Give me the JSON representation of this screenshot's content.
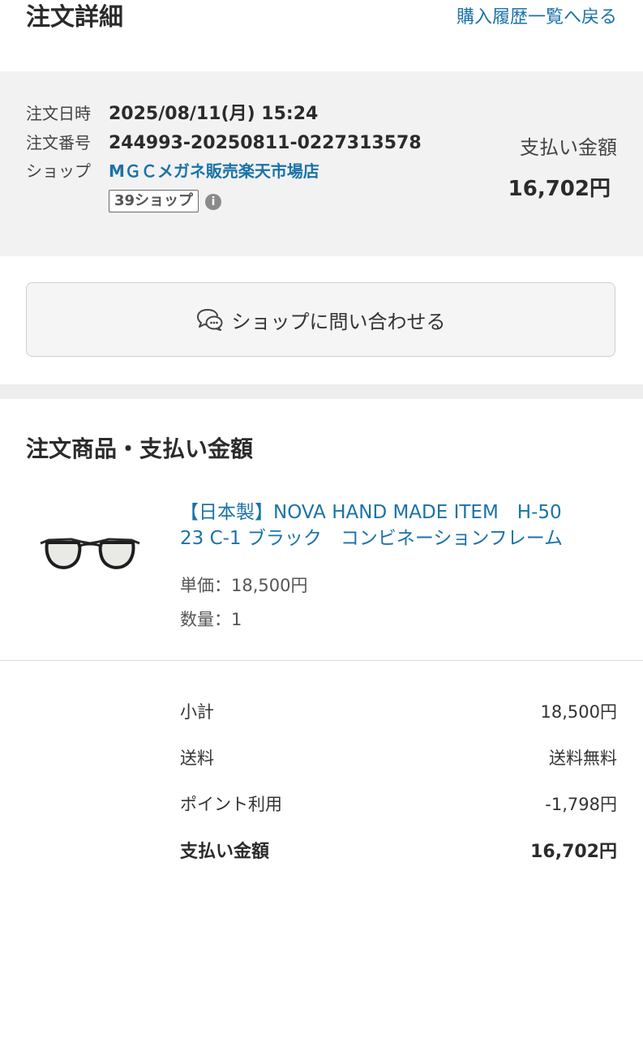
{
  "header": {
    "title": "注文詳細",
    "back_link": "購入履歴一覧へ戻る"
  },
  "order": {
    "date_label": "注文日時",
    "date_value": "2025/08/11(月) 15:24",
    "number_label": "注文番号",
    "number_value": "244993-20250811-0227313578",
    "shop_label": "ショップ",
    "shop_name": "MＧＣメガネ販売楽天市場店",
    "shop_badge": "39ショップ",
    "info_icon": "i",
    "payment_label": "支払い金額",
    "payment_amount": "16,702円"
  },
  "contact": {
    "button_label": "ショップに問い合わせる",
    "icon": "chat-bubbles-icon"
  },
  "items_section": {
    "title": "注文商品・支払い金額",
    "product": {
      "name_line1": "【日本製】NOVA HAND MADE ITEM　H-50",
      "name_line2": "23 C-1 ブラック　コンビネーションフレーム",
      "unit_price": "単価：18,500円",
      "quantity": "数量：1",
      "image": "eyeglasses-image"
    }
  },
  "totals": {
    "subtotal_label": "小計",
    "subtotal_value": "18,500円",
    "shipping_label": "送料",
    "shipping_value": "送料無料",
    "points_label": "ポイント利用",
    "points_value": "-1,798円",
    "total_label": "支払い金額",
    "total_value": "16,702円"
  },
  "colors": {
    "link": "#1a73a8",
    "summary_bg": "#f2f2f2",
    "text": "#333333"
  }
}
